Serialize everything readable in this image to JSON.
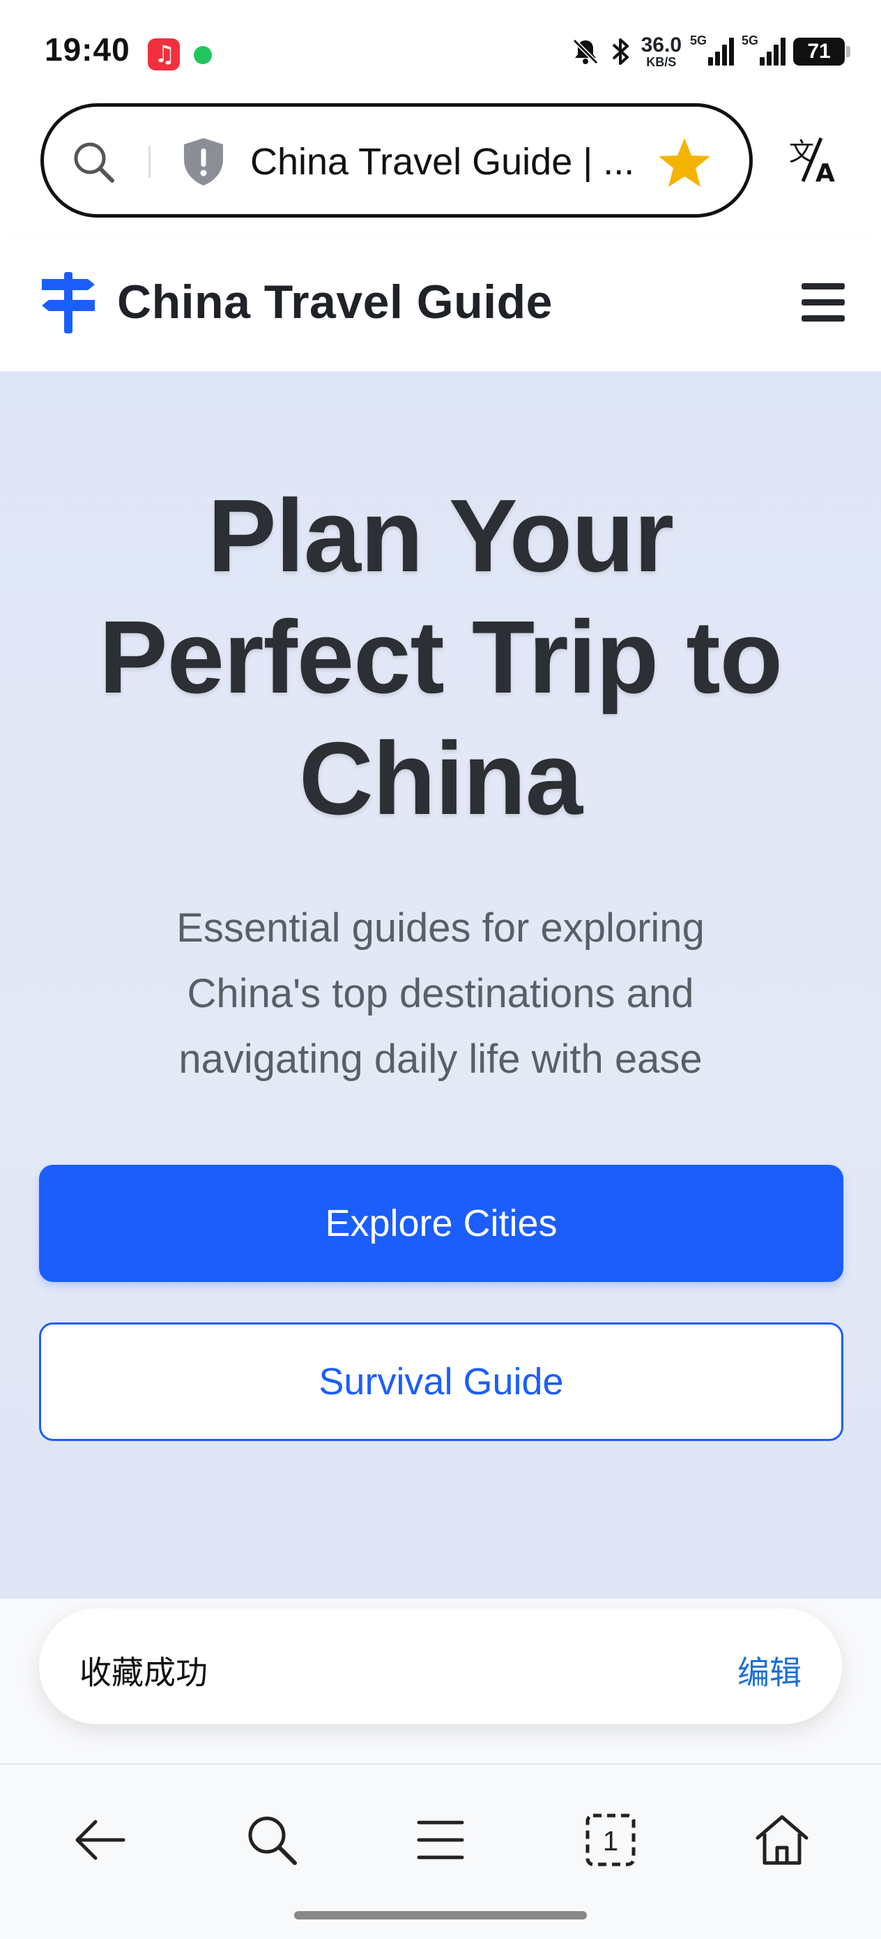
{
  "status_bar": {
    "time": "19:40",
    "net_speed_value": "36.0",
    "net_speed_unit": "KB/S",
    "sim1_label": "5G",
    "sim2_label": "5G",
    "battery": "71",
    "icons": [
      "music-app-icon",
      "chat-app-icon",
      "mute-icon",
      "bluetooth-icon"
    ]
  },
  "browser": {
    "address_title": "China Travel Guide | ...",
    "bookmarked": true,
    "star_color": "#f5b301"
  },
  "site": {
    "name": "China Travel Guide",
    "brand_color": "#1b5efc"
  },
  "hero": {
    "title_line1": "Plan Your",
    "title_line2": "Perfect Trip to",
    "title_line3": "China",
    "subtitle_line1": "Essential guides for exploring",
    "subtitle_line2": "China's top destinations and",
    "subtitle_line3": "navigating daily life with ease",
    "primary_button": "Explore Cities",
    "secondary_button": "Survival Guide"
  },
  "toast": {
    "message": "收藏成功",
    "action": "编辑"
  },
  "bottom_nav": {
    "tabs_count": "1",
    "items": [
      "back-icon",
      "search-icon",
      "menu-icon",
      "tabs-icon",
      "home-icon"
    ]
  }
}
